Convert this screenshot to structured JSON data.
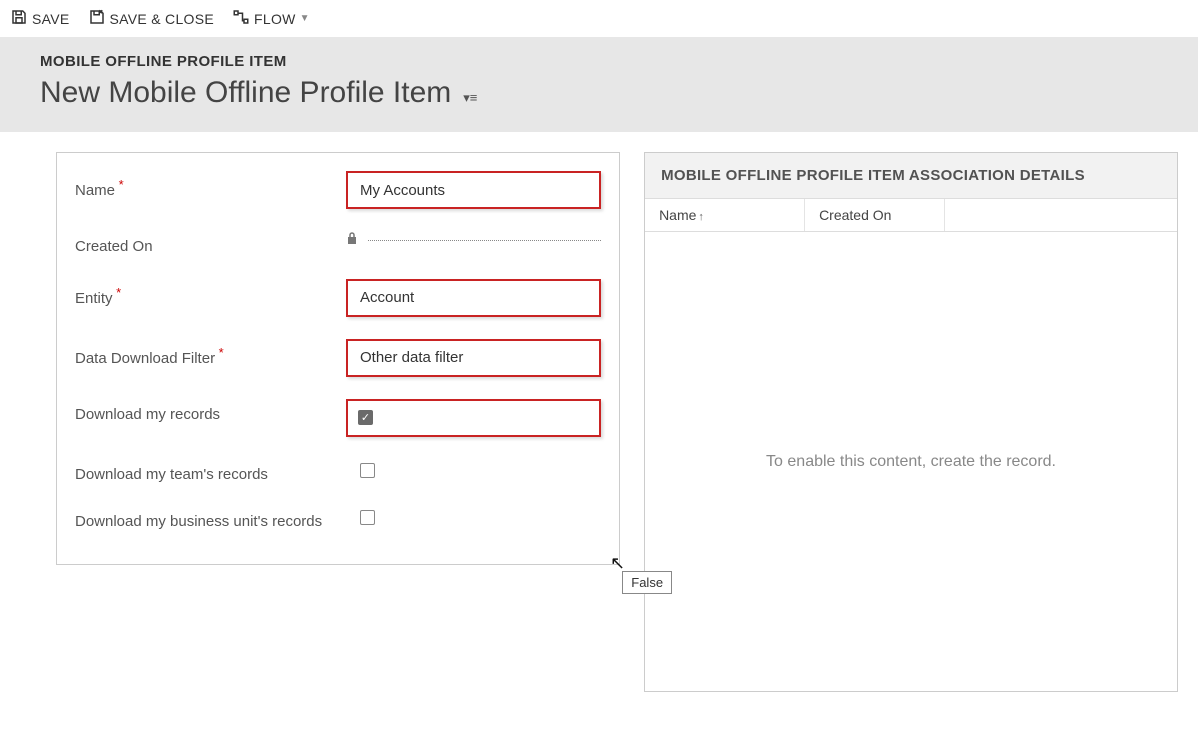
{
  "toolbar": {
    "save": "SAVE",
    "saveClose": "SAVE & CLOSE",
    "flow": "FLOW"
  },
  "header": {
    "entityType": "MOBILE OFFLINE PROFILE ITEM",
    "recordTitle": "New Mobile Offline Profile Item"
  },
  "form": {
    "nameLabel": "Name",
    "nameValue": "My Accounts",
    "createdOnLabel": "Created On",
    "entityLabel": "Entity",
    "entityValue": "Account",
    "filterLabel": "Data Download Filter",
    "filterValue": "Other data filter",
    "dlMyLabel": "Download my records",
    "dlTeamLabel": "Download my team's records",
    "dlBuLabel": "Download my business unit's records"
  },
  "tooltip": "False",
  "assoc": {
    "title": "MOBILE OFFLINE PROFILE ITEM ASSOCIATION DETAILS",
    "colName": "Name",
    "colCreated": "Created On",
    "empty": "To enable this content, create the record."
  }
}
